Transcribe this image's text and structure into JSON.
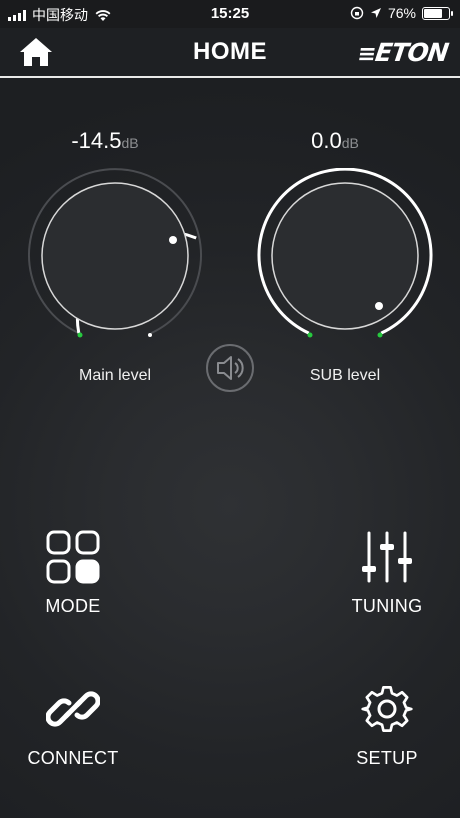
{
  "status_bar": {
    "carrier": "中国移动",
    "time": "15:25",
    "battery": "76%",
    "battery_level": 0.76
  },
  "nav": {
    "title": "HOME",
    "brand": "ETON",
    "home_icon": "home-icon"
  },
  "knobs": {
    "main": {
      "value": "-14.5",
      "unit": "dB",
      "label": "Main level"
    },
    "sub": {
      "value": "0.0",
      "unit": "dB",
      "label": "SUB level"
    }
  },
  "speaker_icon": "speaker-icon",
  "actions": {
    "mode": {
      "label": "MODE",
      "icon": "grid-icon"
    },
    "tuning": {
      "label": "TUNING",
      "icon": "sliders-icon"
    },
    "connect": {
      "label": "CONNECT",
      "icon": "link-icon"
    },
    "setup": {
      "label": "SETUP",
      "icon": "gear-icon"
    }
  },
  "colors": {
    "background": "#232528",
    "accent": "#ffffff",
    "indicator_green": "#27c93f"
  }
}
